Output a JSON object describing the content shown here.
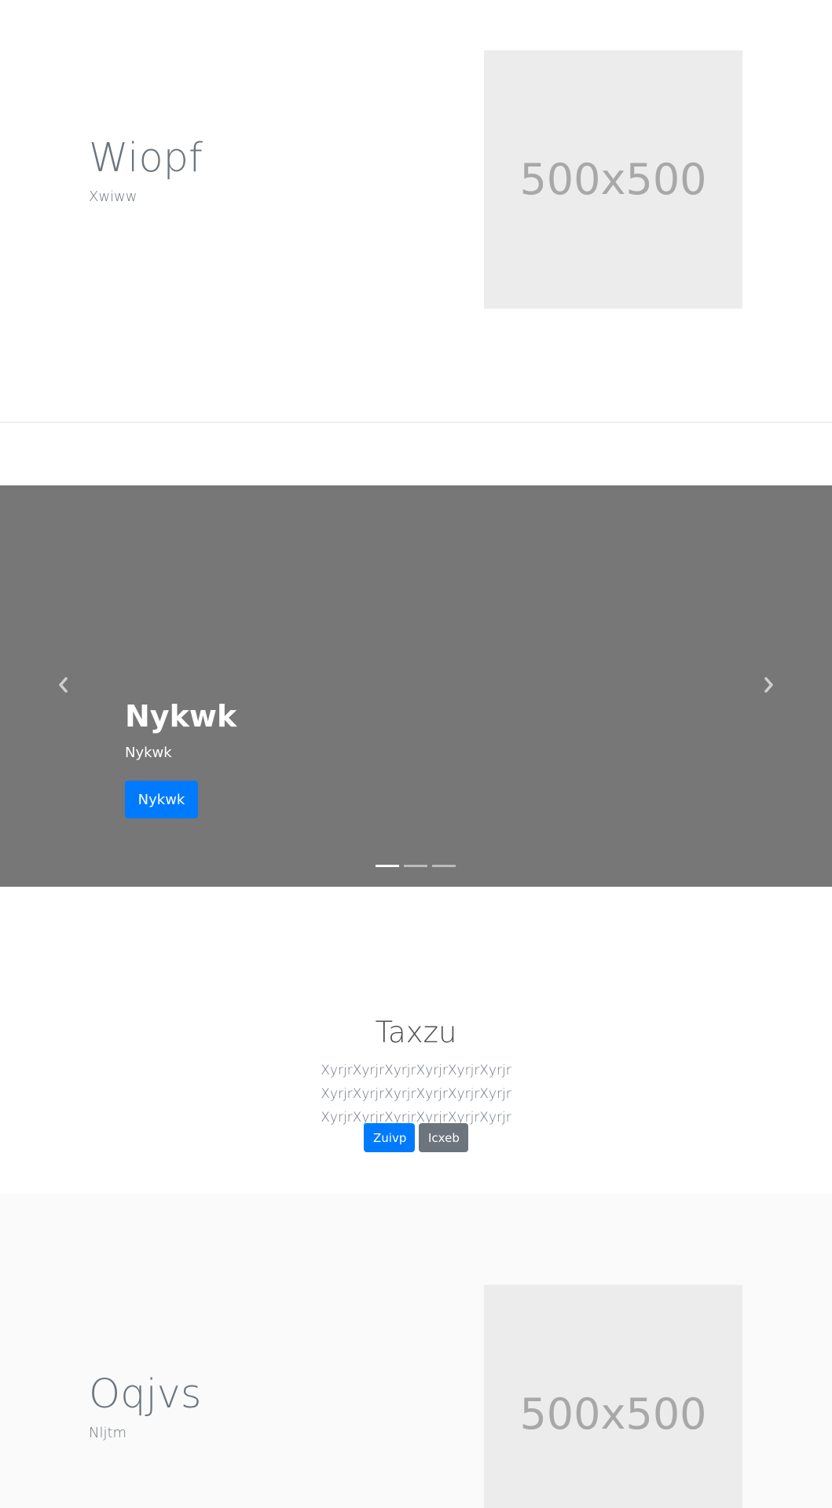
{
  "section1": {
    "title": "Wiopf",
    "subtitle": "Xwiww",
    "image_label": "500x500"
  },
  "carousel": {
    "title": "Nykwk",
    "text": "Nykwk",
    "button_label": "Nykwk",
    "slide_count": 3,
    "active_slide": 1,
    "prev_icon": "chevron-left-icon",
    "next_icon": "chevron-right-icon",
    "background_color": "#777777",
    "button_color": "#007bff"
  },
  "section2": {
    "heading": "Taxzu",
    "lead": "XyrjrXyrjrXyrjrXyrjrXyrjrXyrjr XyrjrXyrjrXyrjrXyrjrXyrjrXyrjr XyrjrXyrjrXyrjrXyrjrXyrjrXyrjr",
    "primary_button": "Zuivp",
    "secondary_button": "Icxeb",
    "primary_color": "#007bff",
    "secondary_color": "#6c757d"
  },
  "section3": {
    "title": "Oqjvs",
    "subtitle": "Nljtm",
    "image_label": "500x500"
  }
}
